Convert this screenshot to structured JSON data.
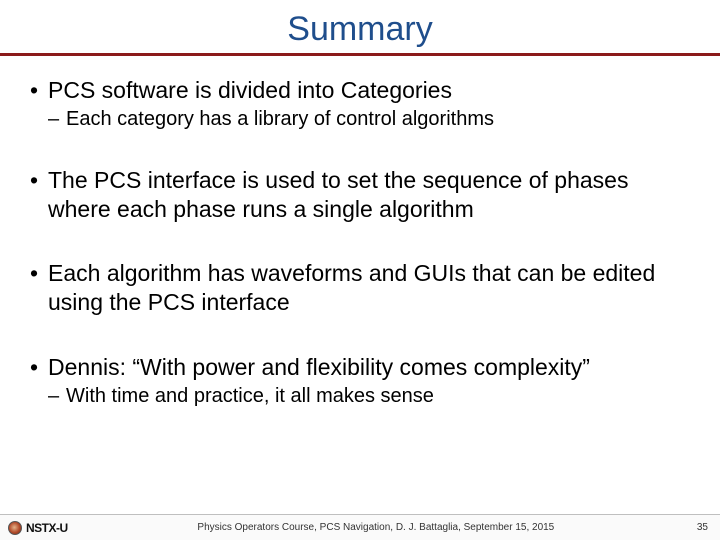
{
  "title": "Summary",
  "bullets": [
    {
      "level": 1,
      "text": "PCS software is divided into Categories"
    },
    {
      "level": 2,
      "text": "Each category has a library of control algorithms"
    },
    {
      "level": 0,
      "text": ""
    },
    {
      "level": 1,
      "text": "The PCS interface is used to set the sequence of phases where each phase runs a single algorithm"
    },
    {
      "level": 0,
      "text": ""
    },
    {
      "level": 1,
      "text": "Each algorithm has waveforms and GUIs that can be edited using the PCS interface"
    },
    {
      "level": 0,
      "text": ""
    },
    {
      "level": 1,
      "text": "Dennis: “With power and flexibility comes complexity”"
    },
    {
      "level": 2,
      "text": "With time and practice, it all makes sense"
    }
  ],
  "footer": {
    "logo_text": "NSTX-U",
    "center": "Physics Operators Course, PCS Navigation, D. J. Battaglia, September 15, 2015",
    "page": "35"
  }
}
